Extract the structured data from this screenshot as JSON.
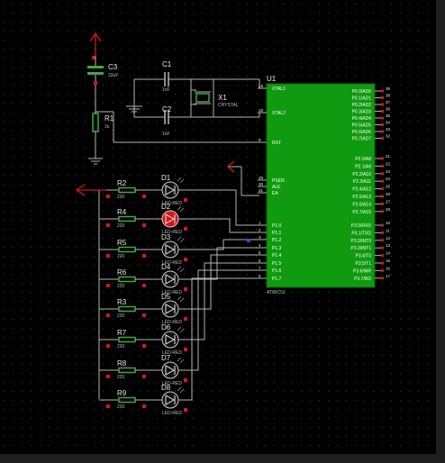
{
  "colors": {
    "background": "#000000",
    "grid": "#3a3a3a",
    "wire": "#b4b4b4",
    "chip": "#0f9a0f",
    "pin_text": "#ffffff",
    "led_off": "#111111",
    "led_on": "#d41717",
    "power": "#d41717",
    "resistor": "#3fa83f"
  },
  "capacitors": [
    {
      "ref": "C3",
      "value": "22uF"
    },
    {
      "ref": "C1",
      "value": "1nF"
    },
    {
      "ref": "C2",
      "value": "1nF"
    }
  ],
  "r1": {
    "ref": "R1",
    "value": "1k"
  },
  "crystal": {
    "ref": "X1",
    "value": "CRYSTAL"
  },
  "mcu": {
    "ref": "U1",
    "part": "AT89C51",
    "left_pins": [
      {
        "num": "19",
        "name": "XTAL1"
      },
      {
        "num": "18",
        "name": "XTAL2"
      },
      {
        "num": "9",
        "name": "RST"
      },
      {
        "num": "29",
        "name": "PSEN"
      },
      {
        "num": "30",
        "name": "ALE"
      },
      {
        "num": "31",
        "name": "EA"
      },
      {
        "num": "1",
        "name": "P1.0"
      },
      {
        "num": "2",
        "name": "P1.1"
      },
      {
        "num": "3",
        "name": "P1.2"
      },
      {
        "num": "4",
        "name": "P1.3"
      },
      {
        "num": "5",
        "name": "P1.4"
      },
      {
        "num": "6",
        "name": "P1.5"
      },
      {
        "num": "7",
        "name": "P1.6"
      },
      {
        "num": "8",
        "name": "P1.7"
      }
    ],
    "port0": [
      {
        "num": "39",
        "name": "P0.0/AD0"
      },
      {
        "num": "38",
        "name": "P0.1/AD1"
      },
      {
        "num": "37",
        "name": "P0.2/AD2"
      },
      {
        "num": "36",
        "name": "P0.3/AD3"
      },
      {
        "num": "35",
        "name": "P0.4/AD4"
      },
      {
        "num": "34",
        "name": "P0.5/AD5"
      },
      {
        "num": "33",
        "name": "P0.6/AD6"
      },
      {
        "num": "32",
        "name": "P0.7/AD7"
      }
    ],
    "port2": [
      {
        "num": "21",
        "name": "P2.0/A8"
      },
      {
        "num": "22",
        "name": "P2.1/A9"
      },
      {
        "num": "23",
        "name": "P2.2/A10"
      },
      {
        "num": "24",
        "name": "P2.3/A11"
      },
      {
        "num": "25",
        "name": "P2.4/A12"
      },
      {
        "num": "26",
        "name": "P2.5/A13"
      },
      {
        "num": "27",
        "name": "P2.6/A14"
      },
      {
        "num": "28",
        "name": "P2.7/A15"
      }
    ],
    "port3": [
      {
        "num": "10",
        "name": "P3.0/RXD"
      },
      {
        "num": "11",
        "name": "P3.1/TXD"
      },
      {
        "num": "12",
        "name": "P3.2/INT0"
      },
      {
        "num": "13",
        "name": "P3.3/INT1"
      },
      {
        "num": "14",
        "name": "P3.4/T0"
      },
      {
        "num": "15",
        "name": "P3.5/T1"
      },
      {
        "num": "16",
        "name": "P3.6/WR"
      },
      {
        "num": "17",
        "name": "P3.7/RD"
      }
    ]
  },
  "led_rows": [
    {
      "resistor": "R2",
      "value": "220",
      "led": "D1",
      "led_value": "LED-RED",
      "lit": false
    },
    {
      "resistor": "R4",
      "value": "220",
      "led": "D2",
      "led_value": "LED-RED",
      "lit": true
    },
    {
      "resistor": "R5",
      "value": "220",
      "led": "D3",
      "led_value": "LED-RED",
      "lit": false
    },
    {
      "resistor": "R6",
      "value": "220",
      "led": "D4",
      "led_value": "LED-RED",
      "lit": false
    },
    {
      "resistor": "R3",
      "value": "220",
      "led": "D5",
      "led_value": "LED-RED",
      "lit": false
    },
    {
      "resistor": "R7",
      "value": "220",
      "led": "D6",
      "led_value": "LED-RED",
      "lit": false
    },
    {
      "resistor": "R8",
      "value": "220",
      "led": "D7",
      "led_value": "LED-RED",
      "lit": false
    },
    {
      "resistor": "R9",
      "value": "220",
      "led": "D8",
      "led_value": "LED-RED",
      "lit": false
    }
  ]
}
